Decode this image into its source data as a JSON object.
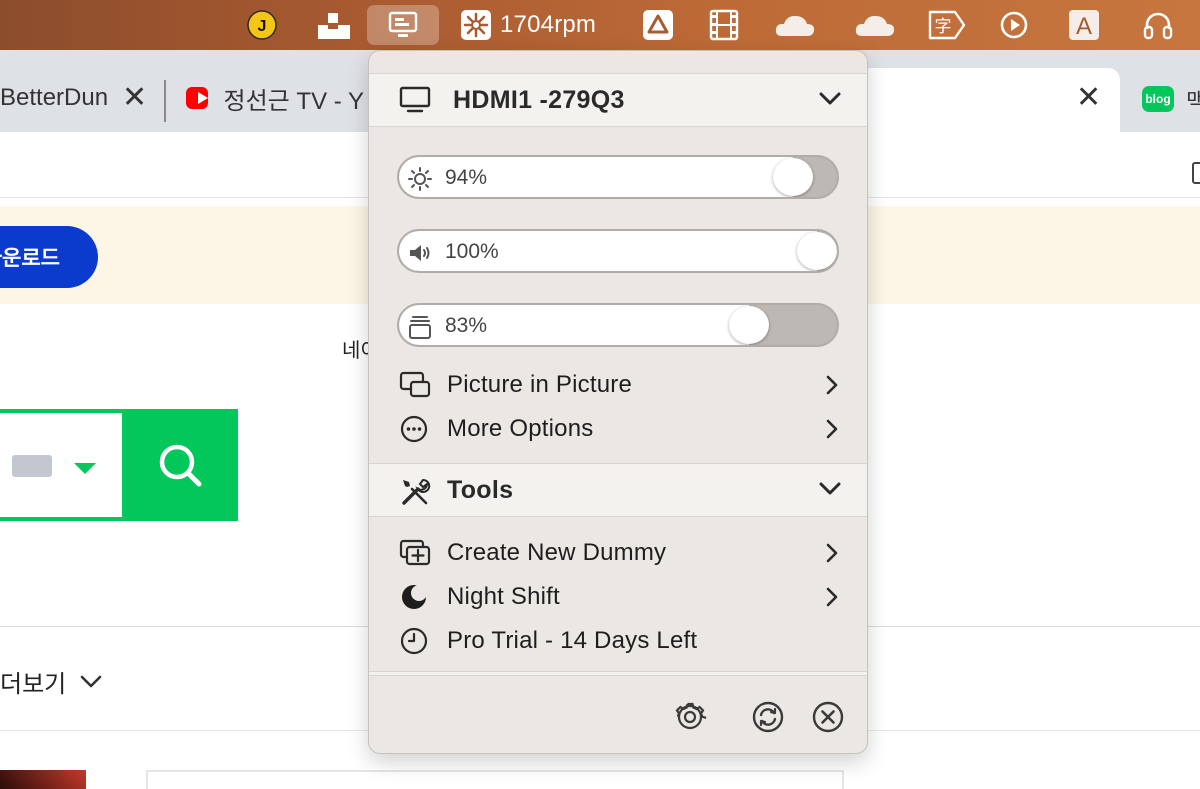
{
  "menubar": {
    "icons": [
      "jumpcut-icon",
      "dock-icon",
      "betterdummy-display-icon",
      "fan-icon",
      "google-drive-icon",
      "film-icon",
      "onedrive-icon",
      "onedrive-alt-icon",
      "input-method-icon",
      "play-circle-icon",
      "font-icon",
      "headphones-icon"
    ],
    "jumpcut_letter": "J",
    "fan_speed": "1704rpm",
    "font_letter": "A"
  },
  "browser": {
    "tabs": [
      {
        "label": "BetterDun",
        "active": false
      },
      {
        "label": "정선근 TV - Y",
        "active": false
      },
      {
        "label": "",
        "active": true
      }
    ],
    "blog_favicon": "blog",
    "right_tab_fragment": "맥"
  },
  "page": {
    "download_button": "다운로드",
    "naver_text": "네이",
    "more_link": "더보기"
  },
  "popup": {
    "display_header": "HDMI1 -279Q3",
    "sliders": [
      {
        "name": "brightness",
        "label": "94%",
        "value": 94
      },
      {
        "name": "volume",
        "label": "100%",
        "value": 100
      },
      {
        "name": "contrast",
        "label": "83%",
        "value": 83
      }
    ],
    "display_items": [
      {
        "label": "Picture in Picture",
        "has_submenu": true
      },
      {
        "label": "More Options",
        "has_submenu": true
      }
    ],
    "tools_header": "Tools",
    "tools_items": [
      {
        "label": "Create New Dummy",
        "has_submenu": true
      },
      {
        "label": "Night Shift",
        "has_submenu": true
      },
      {
        "label": "Pro Trial - 14 Days Left",
        "has_submenu": false
      }
    ],
    "footer_icons": [
      "gear-icon",
      "refresh-icon",
      "close-circle-icon"
    ]
  },
  "colors": {
    "menubar_brown": "#a85a30",
    "naver_green": "#03c75a",
    "download_blue": "#0a3bcc",
    "popup_bg": "#ebe7e3",
    "slider_track": "#bdb8b3"
  }
}
